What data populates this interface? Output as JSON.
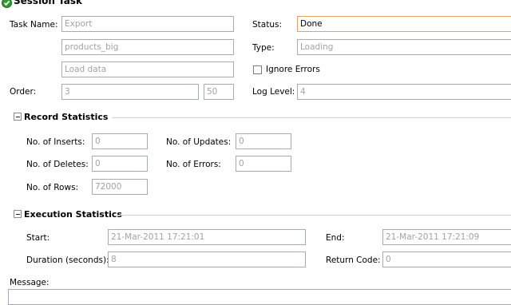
{
  "title": "Session Task",
  "task": {
    "name_label": "Task Name:",
    "name_value": "Export",
    "line2_value": "products_big",
    "line3_value": "Load data",
    "status_label": "Status:",
    "status_value": "Done",
    "type_label": "Type:",
    "type_value": "Loading",
    "ignore_errors_label": "Ignore Errors",
    "order_label": "Order:",
    "order_value": "3",
    "order_secondary_value": "50",
    "log_level_label": "Log Level:",
    "log_level_value": "4"
  },
  "record_statistics": {
    "header": "Record Statistics",
    "inserts_label": "No. of Inserts:",
    "inserts_value": "0",
    "updates_label": "No. of Updates:",
    "updates_value": "0",
    "deletes_label": "No. of Deletes:",
    "deletes_value": "0",
    "errors_label": "No. of Errors:",
    "errors_value": "0",
    "rows_label": "No. of Rows:",
    "rows_value": "72000"
  },
  "execution_statistics": {
    "header": "Execution Statistics",
    "start_label": "Start:",
    "start_value": "21-Mar-2011 17:21:01",
    "end_label": "End:",
    "end_value": "21-Mar-2011 17:21:09",
    "duration_label": "Duration (seconds):",
    "duration_value": "8",
    "return_code_label": "Return Code:",
    "return_code_value": "0"
  },
  "message_label": "Message:",
  "colors": {
    "icon_green": "#2e9a2e",
    "active_border": "#e3a36a",
    "field_border": "#a5acb5"
  }
}
